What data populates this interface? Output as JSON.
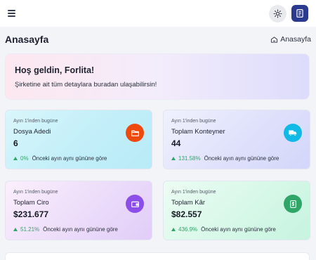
{
  "header": {
    "title": "Anasayfa",
    "breadcrumb": "Anasayfa"
  },
  "welcome": {
    "title": "Hoş geldin, Forlita!",
    "message": "Şirketine ait tüm detaylara buradan ulaşabilirsin!"
  },
  "cards": [
    {
      "sub": "Ayın 1'inden bugüne",
      "label": "Dosya Adedi",
      "value": "6",
      "change": "0%",
      "comparison": "Önceki ayın aynı gününe göre",
      "icon": "folder-icon",
      "icon_color": "#ef4a0d"
    },
    {
      "sub": "Ayın 1'inden bugüne",
      "label": "Toplam Konteyner",
      "value": "44",
      "change": "131.58%",
      "comparison": "Önceki ayın aynı gününe göre",
      "icon": "truck-icon",
      "icon_color": "#10b9e6"
    },
    {
      "sub": "Ayın 1'inden bugüne",
      "label": "Toplam Ciro",
      "value": "$231.677",
      "change": "51.21%",
      "comparison": "Önceki ayın aynı gününe göre",
      "icon": "wallet-icon",
      "icon_color": "#8b4ee8"
    },
    {
      "sub": "Ayın 1'inden bugüne",
      "label": "Toplam Kâr",
      "value": "$82.557",
      "change": "436.9%",
      "comparison": "Önceki ayın aynı gününe göre",
      "icon": "dollar-document-icon",
      "icon_color": "#2fa567"
    }
  ],
  "colors": {
    "trend_up": "#2fa567",
    "avatar_bg": "#2a3a8f"
  }
}
